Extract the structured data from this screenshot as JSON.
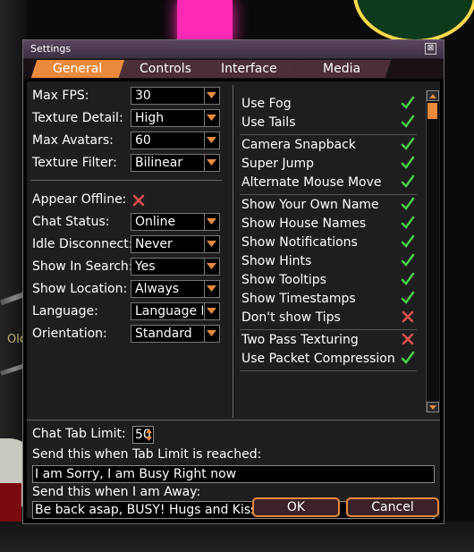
{
  "window": {
    "title": "Settings",
    "close_glyph": "⊠"
  },
  "background": {
    "avatar_name": "Oldre_CSH"
  },
  "tabs": [
    {
      "label": "General",
      "active": true
    },
    {
      "label": "Controls",
      "active": false
    },
    {
      "label": "Interface",
      "active": false
    },
    {
      "label": "Media",
      "active": false
    }
  ],
  "settings": {
    "max_fps": {
      "label": "Max FPS:",
      "value": "30"
    },
    "texture_detail": {
      "label": "Texture Detail:",
      "value": "High"
    },
    "max_avatars": {
      "label": "Max Avatars:",
      "value": "60"
    },
    "texture_filter": {
      "label": "Texture Filter:",
      "value": "Bilinear"
    },
    "appear_offline": {
      "label": "Appear Offline:",
      "checked": false
    },
    "chat_status": {
      "label": "Chat Status:",
      "value": "Online"
    },
    "idle_disconnect": {
      "label": "Idle Disconnect:",
      "value": "Never"
    },
    "show_in_search": {
      "label": "Show In Search:",
      "value": "Yes"
    },
    "show_location": {
      "label": "Show Location:",
      "value": "Always"
    },
    "language": {
      "label": "Language:",
      "value": "Language F"
    },
    "orientation": {
      "label": "Orientation:",
      "value": "Standard"
    }
  },
  "options": [
    {
      "label": "Use Fog",
      "checked": true
    },
    {
      "label": "Use Tails",
      "checked": true
    },
    {
      "label": "Camera Snapback",
      "checked": true
    },
    {
      "label": "Super Jump",
      "checked": true
    },
    {
      "label": "Alternate Mouse Move",
      "checked": true
    },
    {
      "label": "Show Your Own Name",
      "checked": true
    },
    {
      "label": "Show House Names",
      "checked": true
    },
    {
      "label": "Show Notifications",
      "checked": true
    },
    {
      "label": "Show Hints",
      "checked": true
    },
    {
      "label": "Show Tooltips",
      "checked": true
    },
    {
      "label": "Show Timestamps",
      "checked": true
    },
    {
      "label": "Don't show Tips",
      "checked": false
    },
    {
      "label": "Two Pass Texturing",
      "checked": false
    },
    {
      "label": "Use Packet Compression",
      "checked": true
    }
  ],
  "chat": {
    "tab_limit_label": "Chat Tab Limit:",
    "tab_limit_value": "50",
    "limit_msg_label": "Send this when Tab Limit is reached:",
    "limit_msg_value": "I am Sorry, I am Busy Right now",
    "away_msg_label": "Send this when I am Away:",
    "away_msg_value": "Be back asap, BUSY! Hugs and Kiss until than."
  },
  "buttons": {
    "ok": "OK",
    "cancel": "Cancel"
  },
  "colors": {
    "accent": "#e98a3c",
    "check_green": "#4ccf4c",
    "cross_red": "#e05050"
  }
}
